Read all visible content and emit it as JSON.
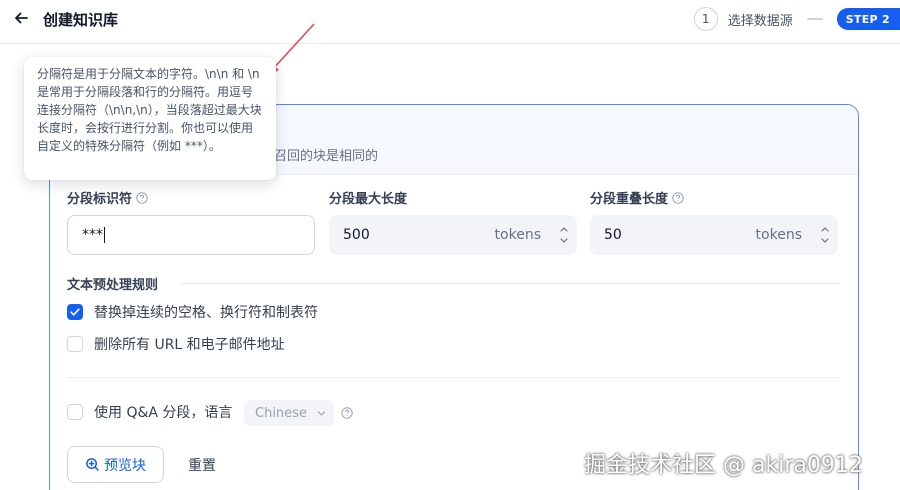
{
  "header": {
    "title": "创建知识库",
    "step1_number": "1",
    "step1_label": "选择数据源",
    "step2_badge": "STEP 2"
  },
  "card": {
    "description": "召回的块是相同的"
  },
  "tooltip": {
    "text": "分隔符是用于分隔文本的字符。\\n\\n 和 \\n 是常用于分隔段落和行的分隔符。用逗号连接分隔符（\\n\\n,\\n），当段落超过最大块长度时，会按行进行分割。你也可以使用自定义的特殊分隔符（例如 ***）。"
  },
  "fields": {
    "separator": {
      "label": "分段标识符",
      "value": "***"
    },
    "max_length": {
      "label": "分段最大长度",
      "value": "500",
      "unit": "tokens"
    },
    "overlap": {
      "label": "分段重叠长度",
      "value": "50",
      "unit": "tokens"
    }
  },
  "rules": {
    "title": "文本预处理规则",
    "replace_spaces": {
      "label": "替换掉连续的空格、换行符和制表符",
      "checked": true
    },
    "remove_urls": {
      "label": "删除所有 URL 和电子邮件地址",
      "checked": false
    }
  },
  "qa": {
    "label": "使用 Q&A 分段，语言",
    "checked": false,
    "language": "Chinese"
  },
  "actions": {
    "preview_label": "预览块",
    "reset_label": "重置"
  },
  "watermark": "掘金技术社区 @ akira0912",
  "colors": {
    "primary": "#155eef",
    "card_border": "#528bff",
    "annotation": "#e5484d"
  },
  "icons": {
    "back": "arrow-left-icon",
    "help": "question-circle-icon",
    "stepper": "chevron-up-down-icon",
    "check": "check-icon",
    "chevron": "chevron-down-icon",
    "preview": "zoom-in-icon"
  }
}
